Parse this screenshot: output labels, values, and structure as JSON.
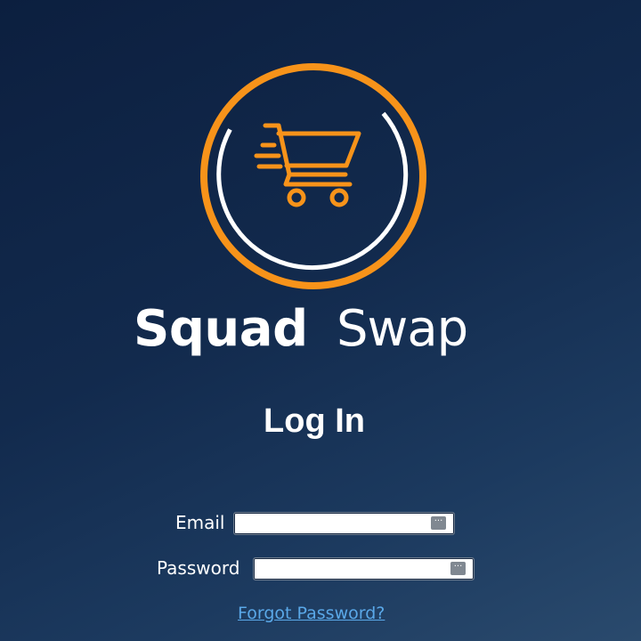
{
  "brand": {
    "name_bold": "Squad",
    "name_light": "Swap",
    "accent_color": "#f7931a"
  },
  "login": {
    "heading": "Log In",
    "email_label": "Email",
    "email_value": "",
    "password_label": "Password",
    "password_value": "",
    "autofill_icon": "key-menu-icon",
    "forgot_link": "Forgot Password?"
  },
  "colors": {
    "background_top": "#0c1f3f",
    "background_bottom": "#2a4a6d",
    "link": "#5aa8e8"
  }
}
